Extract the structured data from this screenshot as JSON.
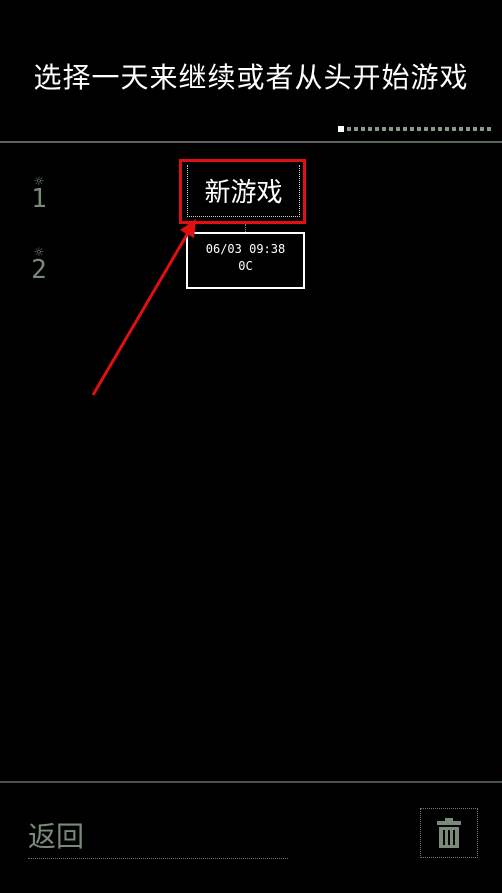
{
  "header": {
    "title": "选择一天来继续或者从头开始游戏"
  },
  "days": [
    {
      "sun": "☼",
      "number": "1"
    },
    {
      "sun": "☼",
      "number": "2"
    }
  ],
  "new_game": {
    "label": "新游戏"
  },
  "save_slot": {
    "datetime": "06/03  09:38",
    "sub": "0C"
  },
  "footer": {
    "back_label": "返回",
    "trash_icon": "trash-icon"
  },
  "colors": {
    "highlight_box": "#e01010",
    "arrow": "#e01010",
    "dim_text": "#7a8a7a",
    "background": "#000000"
  }
}
